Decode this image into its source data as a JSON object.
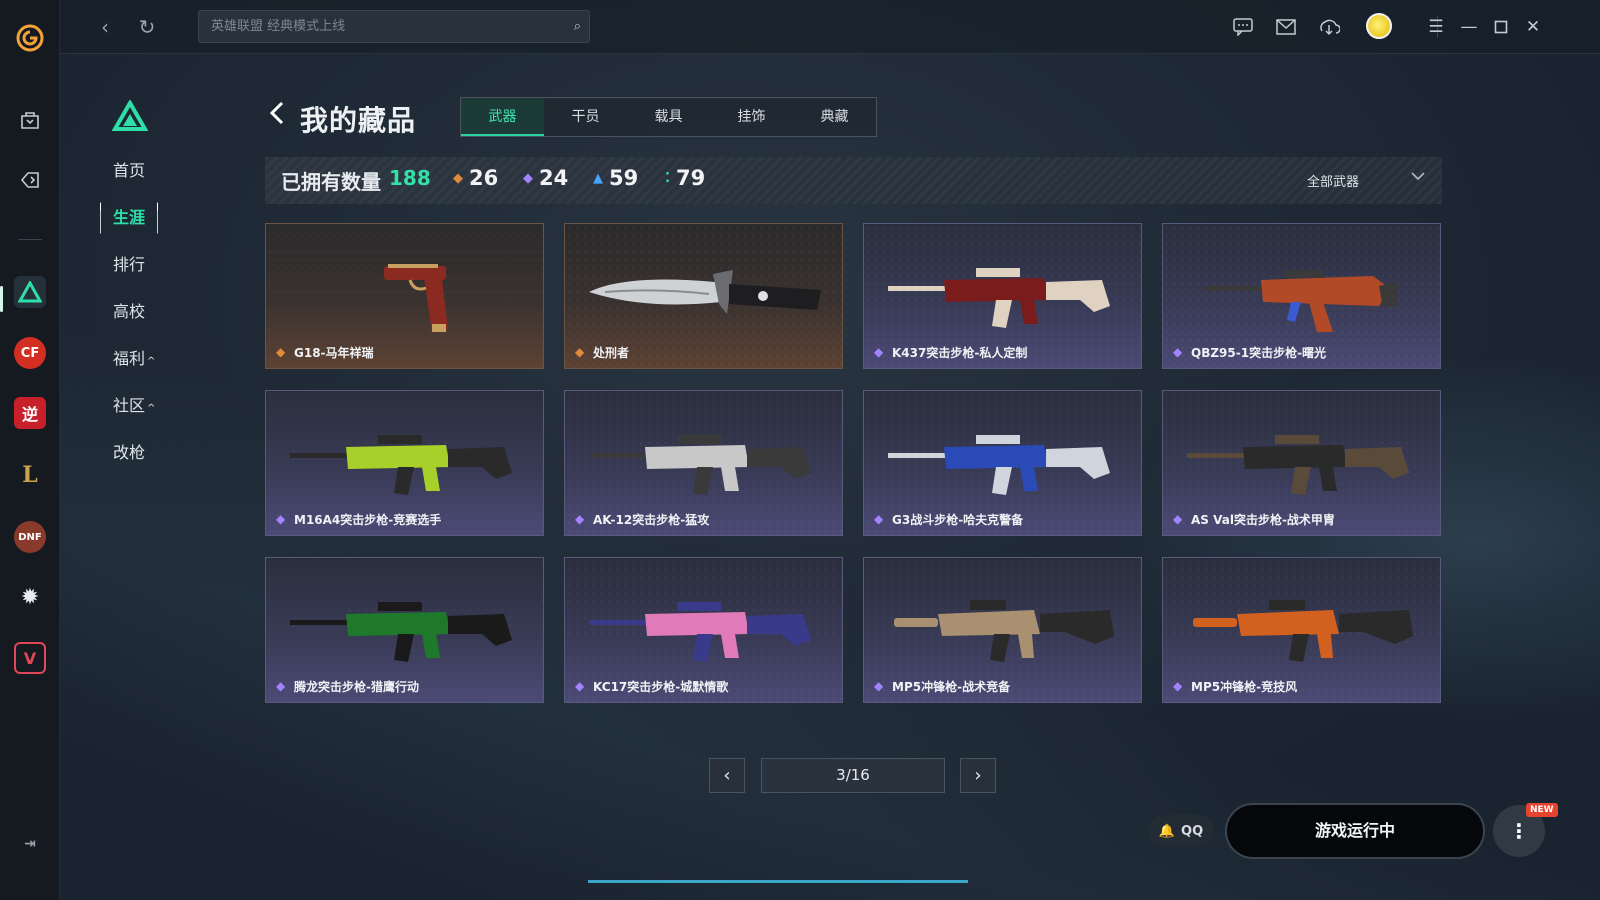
{
  "topbar": {
    "search_placeholder": "英雄联盟 经典模式上线",
    "icons": [
      "back-icon",
      "refresh-icon",
      "chat-icon",
      "mail-icon",
      "download-icon",
      "avatar",
      "menu-icon",
      "minimize-icon",
      "maximize-icon",
      "close-icon"
    ]
  },
  "rail": {
    "apps": [
      "wegame-logo",
      "store-icon",
      "tag-icon",
      "delta-force",
      "crossfire",
      "ni-shui-han",
      "league-of-legends",
      "dnf",
      "settings-star",
      "valorant"
    ]
  },
  "side_nav": {
    "items": [
      {
        "label": "首页",
        "active": false,
        "caret": ""
      },
      {
        "label": "生涯",
        "active": true,
        "caret": ""
      },
      {
        "label": "排行",
        "active": false,
        "caret": ""
      },
      {
        "label": "高校",
        "active": false,
        "caret": ""
      },
      {
        "label": "福利",
        "active": false,
        "caret": "^"
      },
      {
        "label": "社区",
        "active": false,
        "caret": "^"
      },
      {
        "label": "改枪",
        "active": false,
        "caret": ""
      }
    ]
  },
  "page": {
    "title": "我的藏品",
    "tabs": [
      {
        "label": "武器",
        "active": true
      },
      {
        "label": "干员",
        "active": false
      },
      {
        "label": "载具",
        "active": false
      },
      {
        "label": "挂饰",
        "active": false
      },
      {
        "label": "典藏",
        "active": false
      }
    ]
  },
  "stats": {
    "label": "已拥有数量",
    "total": "188",
    "counts": [
      {
        "value": "26",
        "tier": "gold",
        "color": "#e08a3c"
      },
      {
        "value": "24",
        "tier": "purple",
        "color": "#a483ff"
      },
      {
        "value": "59",
        "tier": "blue",
        "color": "#4aa3ff"
      },
      {
        "value": "79",
        "tier": "green",
        "color": "#2ee0a8"
      }
    ],
    "filter": "全部武器"
  },
  "items": [
    {
      "name": "G18-马年祥瑞",
      "tier": "gold",
      "kind": "pistol",
      "palette": [
        "#8a2a20",
        "#c8a060"
      ]
    },
    {
      "name": "处刑者",
      "tier": "gold",
      "kind": "knife",
      "palette": [
        "#cfd2d4",
        "#1e1e20"
      ]
    },
    {
      "name": "K437突击步枪-私人定制",
      "tier": "purple",
      "kind": "rifle",
      "palette": [
        "#7a1c1c",
        "#e0d2c0"
      ]
    },
    {
      "name": "QBZ95-1突击步枪-曙光",
      "tier": "purple",
      "kind": "bullpup",
      "palette": [
        "#b24a28",
        "#3a3a3a"
      ]
    },
    {
      "name": "M16A4突击步枪-竞赛选手",
      "tier": "purple",
      "kind": "rifle",
      "palette": [
        "#a8d02a",
        "#2a2a2a"
      ]
    },
    {
      "name": "AK-12突击步枪-猛攻",
      "tier": "purple",
      "kind": "rifle",
      "palette": [
        "#c8c8c8",
        "#3a3a3a"
      ]
    },
    {
      "name": "G3战斗步枪-哈夫克警备",
      "tier": "purple",
      "kind": "rifle",
      "palette": [
        "#2a4ab8",
        "#d0d4dc"
      ]
    },
    {
      "name": "AS Val突击步枪-战术甲胄",
      "tier": "purple",
      "kind": "rifle",
      "palette": [
        "#2a2a2a",
        "#5a4a3a"
      ]
    },
    {
      "name": "腾龙突击步枪-猎鹰行动",
      "tier": "purple",
      "kind": "rifle",
      "palette": [
        "#1e7a2a",
        "#1a1a1a"
      ]
    },
    {
      "name": "KC17突击步枪-城默情歌",
      "tier": "purple",
      "kind": "rifle",
      "palette": [
        "#e07ab8",
        "#3a3a8a"
      ]
    },
    {
      "name": "MP5冲锋枪-战术竞备",
      "tier": "purple",
      "kind": "smg",
      "palette": [
        "#a89070",
        "#2a2a2a"
      ]
    },
    {
      "name": "MP5冲锋枪-竞技风",
      "tier": "purple",
      "kind": "smg",
      "palette": [
        "#d2601e",
        "#2a2a2a"
      ]
    }
  ],
  "pager": {
    "text": "3/16"
  },
  "bottom": {
    "qq_label": "QQ",
    "run_label": "游戏运行中",
    "new_badge": "NEW"
  }
}
